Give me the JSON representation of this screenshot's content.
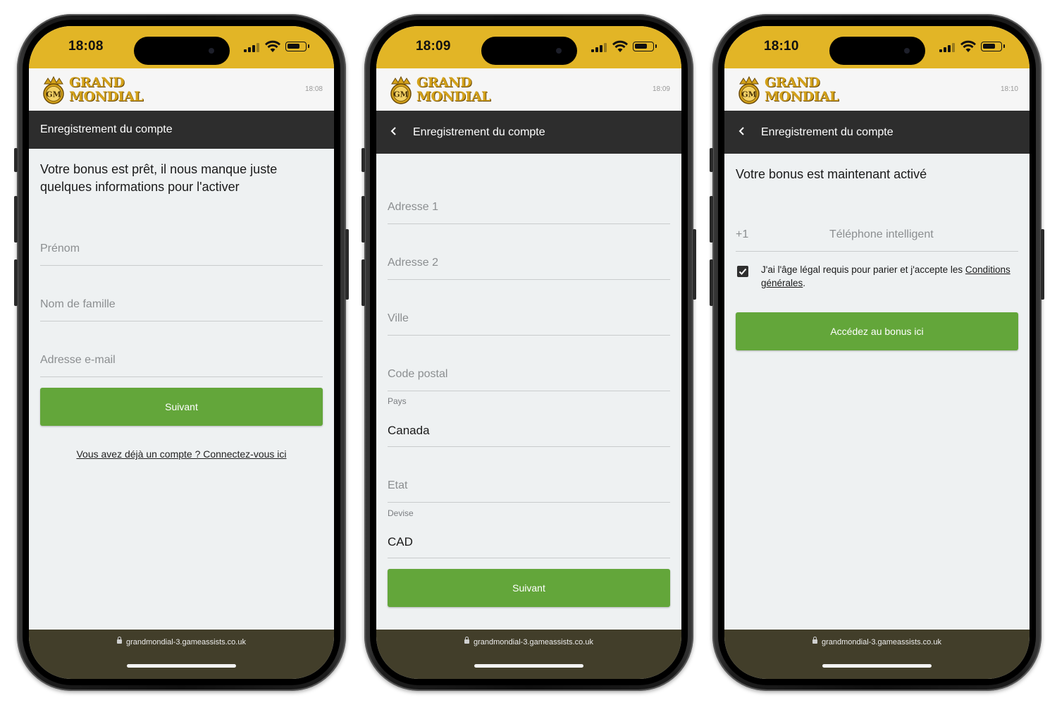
{
  "brand": {
    "logo_emblem_text": "GM",
    "logo_line1": "GRAND",
    "logo_line2": "MONDIAL",
    "accent_gold": "#e2b526",
    "button_green": "#63a63a",
    "header_dark": "#2d2d2d"
  },
  "url": "grandmondial-3.gameassists.co.uk",
  "screens": [
    {
      "status_time": "18:08",
      "page_clock": "18:08",
      "header_title": "Enregistrement du compte",
      "has_back": false,
      "headline": "Votre bonus est prêt, il nous manque juste quelques informations pour l'activer",
      "fields": [
        {
          "placeholder": "Prénom"
        },
        {
          "placeholder": "Nom de famille"
        },
        {
          "placeholder": "Adresse e-mail"
        }
      ],
      "button_label": "Suivant",
      "login_link": "Vous avez déjà un compte ? Connectez-vous ici"
    },
    {
      "status_time": "18:09",
      "page_clock": "18:09",
      "header_title": "Enregistrement du compte",
      "has_back": true,
      "back_icon": "chevron-left-icon",
      "fields": [
        {
          "placeholder": "Adresse 1"
        },
        {
          "placeholder": "Adresse 2"
        },
        {
          "placeholder": "Ville"
        },
        {
          "placeholder": "Code postal"
        },
        {
          "label": "Pays",
          "value": "Canada"
        },
        {
          "placeholder": "Etat"
        },
        {
          "label": "Devise",
          "value": "CAD"
        }
      ],
      "button_label": "Suivant"
    },
    {
      "status_time": "18:10",
      "page_clock": "18:10",
      "header_title": "Enregistrement du compte",
      "has_back": true,
      "back_icon": "chevron-left-icon",
      "headline": "Votre bonus est maintenant activé",
      "phone_prefix": "+1",
      "phone_placeholder": "Téléphone intelligent",
      "consent_checked": true,
      "consent_text": "J'ai l'âge légal requis pour parier et j'accepte les",
      "consent_link": "Conditions générales",
      "consent_end": ".",
      "button_label": "Accédez au bonus ici"
    }
  ]
}
